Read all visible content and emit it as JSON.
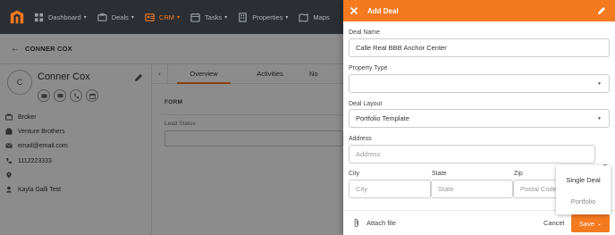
{
  "nav": {
    "items": [
      {
        "label": "Dashboard",
        "icon": "dashboard-icon"
      },
      {
        "label": "Deals",
        "icon": "deals-icon"
      },
      {
        "label": "CRM",
        "icon": "crm-icon"
      },
      {
        "label": "Tasks",
        "icon": "tasks-icon"
      },
      {
        "label": "Properties",
        "icon": "properties-icon"
      },
      {
        "label": "Maps",
        "icon": "maps-icon"
      }
    ],
    "active": "CRM"
  },
  "contact": {
    "breadcrumb": "CONNER COX",
    "avatar_initial": "C",
    "name": "Conner Cox",
    "info": {
      "role": "Broker",
      "company": "Venture Brothers",
      "email": "email@email.com",
      "phone": "1112223333",
      "location": "",
      "owner": "Kayla Galli Test"
    }
  },
  "tabs": {
    "overview": "Overview",
    "activities": "Activities",
    "notes": "No"
  },
  "form": {
    "section": "FORM",
    "lead_status_label": "Lead Status"
  },
  "modal": {
    "title": "Add Deal",
    "deal_name_label": "Deal Name",
    "deal_name_value": "Calle Real BBB Anchor Center",
    "property_type_label": "Property Type",
    "deal_layout_label": "Deal Layout",
    "deal_layout_value": "Portfolio Template",
    "address_label": "Address",
    "address_placeholder": "Address",
    "city_label": "City",
    "city_placeholder": "City",
    "state_label": "State",
    "state_placeholder": "State",
    "zip_label": "Zip",
    "zip_placeholder": "Postal Code",
    "attach_label": "Attach file",
    "cancel_label": "Cancel",
    "save_label": "Save",
    "save_options": [
      "Single Deal",
      "Portfolio"
    ]
  },
  "colors": {
    "accent": "#f47a20",
    "nav_bg": "#2b2f33"
  }
}
